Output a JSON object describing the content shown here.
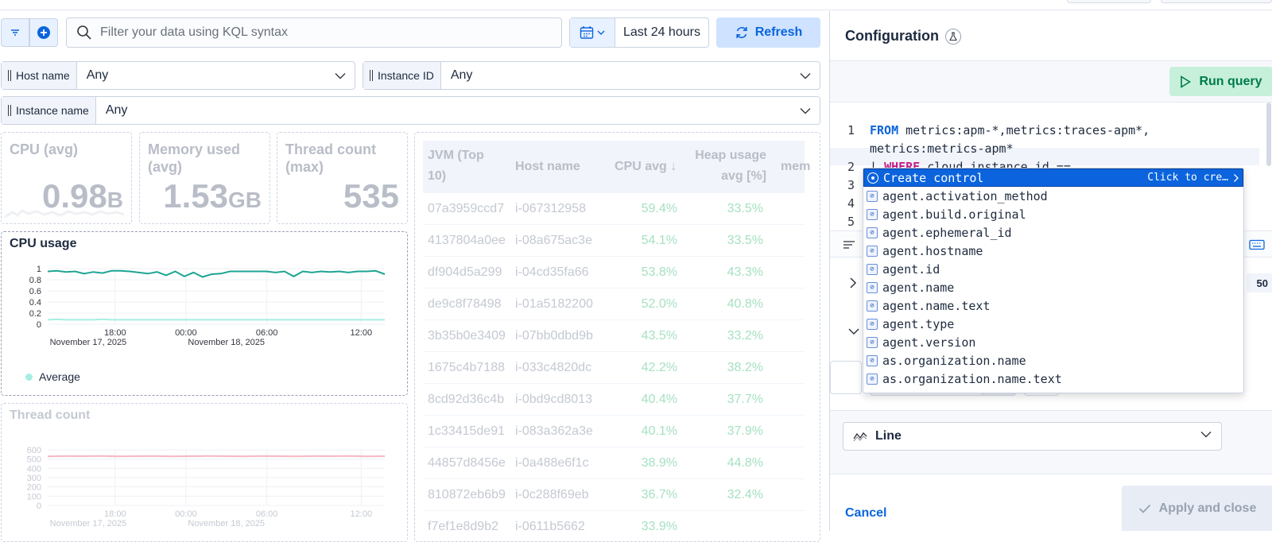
{
  "toolbar": {
    "kql_placeholder": "Filter your data using KQL syntax",
    "time_range": "Last 24 hours",
    "refresh_label": "Refresh"
  },
  "controls": [
    {
      "label": "Host name",
      "value": "Any"
    },
    {
      "label": "Instance ID",
      "value": "Any"
    },
    {
      "label": "Instance name",
      "value": "Any"
    }
  ],
  "metrics": [
    {
      "title_l1": "CPU (avg)",
      "title_l2": "",
      "value": "0.98",
      "unit": "B"
    },
    {
      "title_l1": "Memory used",
      "title_l2": "(avg)",
      "value": "1.53",
      "unit": "GB"
    },
    {
      "title_l1": "Thread count",
      "title_l2": "(max)",
      "value": "535",
      "unit": ""
    }
  ],
  "cpu_chart": {
    "title": "CPU usage",
    "legend": "Average",
    "y_ticks": [
      "1",
      "0.8",
      "0.6",
      "0.4",
      "0.2",
      "0"
    ],
    "x_ticks": [
      "18:00",
      "00:00",
      "06:00",
      "12:00"
    ],
    "x_dates": [
      "November 17, 2025",
      "November 18, 2025"
    ],
    "color_main": "#1ea593",
    "color_avg": "#a6ede3"
  },
  "thread_chart": {
    "title": "Thread count",
    "y_ticks": [
      "600",
      "500",
      "400",
      "300",
      "200",
      "100",
      "0"
    ],
    "x_ticks": [
      "18:00",
      "00:00",
      "06:00",
      "12:00"
    ],
    "x_dates": [
      "November 17, 2025",
      "November 18, 2025"
    ],
    "color": "#f6b7c2"
  },
  "chart_data": [
    {
      "type": "line",
      "title": "CPU usage",
      "ylim": [
        0,
        1.1
      ],
      "series": [
        {
          "name": "",
          "values": [
            0.95,
            0.96,
            0.94,
            0.95,
            0.91,
            0.94,
            0.92,
            0.96,
            0.96,
            0.95,
            0.93,
            0.91,
            0.94,
            0.88,
            0.95,
            0.86,
            0.93,
            0.85,
            0.9,
            0.91,
            0.95,
            0.95,
            0.95,
            0.95,
            0.95,
            0.93,
            0.95,
            0.86,
            0.95,
            0.93,
            0.95,
            0.94,
            0.95,
            0.93,
            0.95,
            0.95,
            0.96,
            0.9
          ]
        },
        {
          "name": "Average",
          "values": [
            0.08,
            0.09,
            0.08,
            0.08,
            0.08,
            0.08,
            0.09,
            0.08,
            0.08,
            0.08,
            0.08,
            0.08,
            0.08,
            0.08,
            0.08,
            0.08,
            0.08,
            0.08,
            0.08,
            0.08,
            0.08,
            0.08,
            0.08,
            0.08,
            0.08,
            0.08,
            0.08,
            0.08,
            0.08,
            0.08,
            0.08,
            0.08,
            0.08,
            0.08,
            0.08,
            0.08,
            0.08,
            0.08
          ]
        }
      ]
    },
    {
      "type": "line",
      "title": "Thread count",
      "ylim": [
        0,
        600
      ],
      "series": [
        {
          "name": "",
          "values": [
            530,
            532,
            531,
            533,
            530,
            531,
            532,
            530,
            531,
            533,
            531,
            530,
            532,
            531,
            530,
            532,
            531,
            533,
            530,
            531
          ]
        }
      ]
    }
  ],
  "table": {
    "headers": [
      "JVM (Top 10)",
      "Host name",
      "CPU avg",
      "Heap usage avg [%]",
      "mem"
    ],
    "rows": [
      [
        "07a3959ccd7",
        "i-067312958",
        "59.4%",
        "33.5%"
      ],
      [
        "4137804a0ee",
        "i-08a675ac3e",
        "54.1%",
        "33.5%"
      ],
      [
        "df904d5a299",
        "i-04cd35fa66",
        "53.8%",
        "43.3%"
      ],
      [
        "de9c8f78498",
        "i-01a5182200",
        "52.0%",
        "40.8%"
      ],
      [
        "3b35b0e3409",
        "i-07bb0dbd9b",
        "43.5%",
        "33.2%"
      ],
      [
        "1675c4b7188",
        "i-033c4820dc",
        "42.2%",
        "38.2%"
      ],
      [
        "8cd92d36c4b",
        "i-0bd9cd8013",
        "40.4%",
        "37.7%"
      ],
      [
        "1c33415de91",
        "i-083a362a3e",
        "40.1%",
        "37.9%"
      ],
      [
        "44857d8456e",
        "i-0a488e6f1c",
        "38.9%",
        "44.8%"
      ],
      [
        "810872eb6b9",
        "i-0c288f69eb",
        "36.7%",
        "32.4%"
      ],
      [
        "f7ef1e8d9b2",
        "i-0611b5662",
        "33.9%",
        ""
      ]
    ]
  },
  "config": {
    "title": "Configuration",
    "run_query": "Run query",
    "code_lines": [
      {
        "n": "1",
        "kw": "FROM",
        "rest": " metrics:apm-*,metrics:traces-apm*,"
      },
      {
        "n": "",
        "kw": "",
        "rest": "metrics:metrics-apm*"
      },
      {
        "n": "2",
        "kw": "WHERE",
        "rest": " cloud.instance.id =="
      },
      {
        "n": "3",
        "kw": "",
        "rest": ""
      },
      {
        "n": "4",
        "kw": "",
        "rest": ""
      },
      {
        "n": "5",
        "kw": "",
        "rest": ""
      }
    ],
    "pipe": "| ",
    "chart_type": "Line",
    "cancel": "Cancel",
    "apply": "Apply and close",
    "partial_count": "50"
  },
  "autocomplete": {
    "first": "Create control",
    "first_hint": "Click to cre…",
    "items": [
      "agent.activation_method",
      "agent.build.original",
      "agent.ephemeral_id",
      "agent.hostname",
      "agent.id",
      "agent.name",
      "agent.name.text",
      "agent.type",
      "agent.version",
      "as.organization.name",
      "as.organization.name.text"
    ]
  }
}
